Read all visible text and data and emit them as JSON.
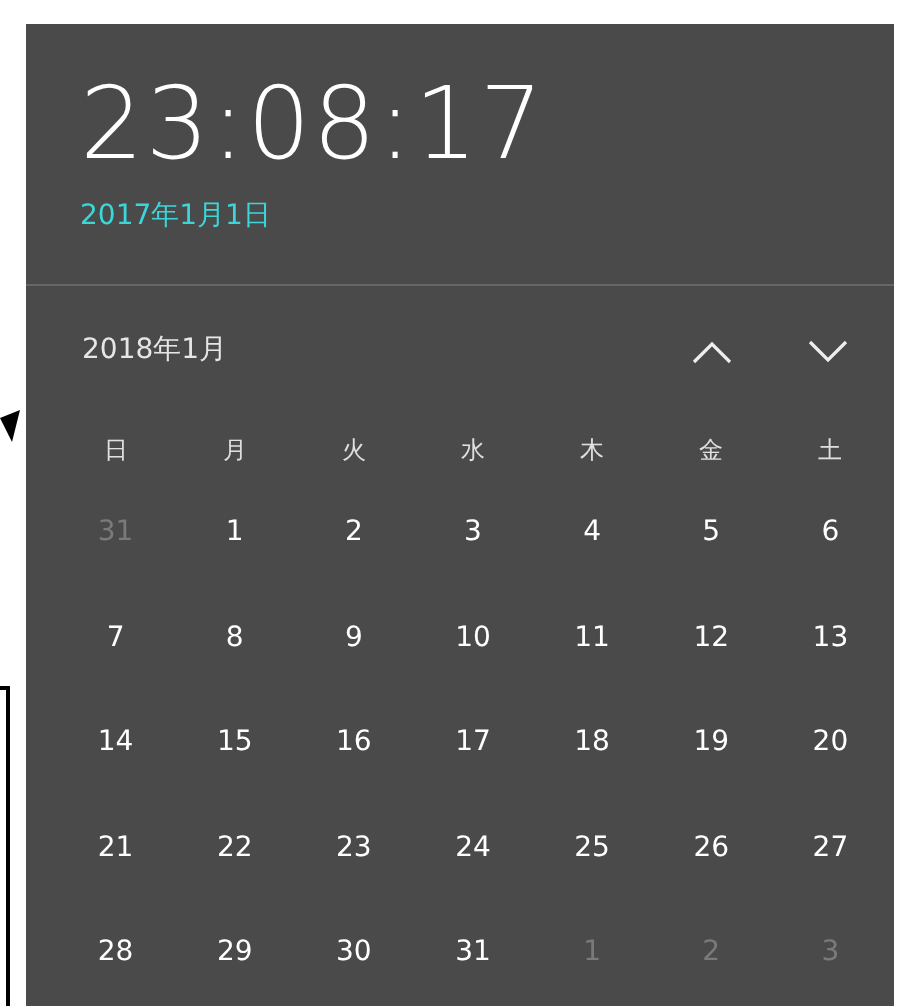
{
  "clock": {
    "time": "23:08:17",
    "date": "2017年1月1日"
  },
  "calendar": {
    "month_label": "2018年1月",
    "weekdays": [
      "日",
      "月",
      "火",
      "水",
      "木",
      "金",
      "土"
    ],
    "weeks": [
      [
        {
          "day": "31",
          "other_month": true
        },
        {
          "day": "1",
          "other_month": false
        },
        {
          "day": "2",
          "other_month": false
        },
        {
          "day": "3",
          "other_month": false
        },
        {
          "day": "4",
          "other_month": false
        },
        {
          "day": "5",
          "other_month": false
        },
        {
          "day": "6",
          "other_month": false
        }
      ],
      [
        {
          "day": "7",
          "other_month": false
        },
        {
          "day": "8",
          "other_month": false
        },
        {
          "day": "9",
          "other_month": false
        },
        {
          "day": "10",
          "other_month": false
        },
        {
          "day": "11",
          "other_month": false
        },
        {
          "day": "12",
          "other_month": false
        },
        {
          "day": "13",
          "other_month": false
        }
      ],
      [
        {
          "day": "14",
          "other_month": false
        },
        {
          "day": "15",
          "other_month": false
        },
        {
          "day": "16",
          "other_month": false
        },
        {
          "day": "17",
          "other_month": false
        },
        {
          "day": "18",
          "other_month": false
        },
        {
          "day": "19",
          "other_month": false
        },
        {
          "day": "20",
          "other_month": false
        }
      ],
      [
        {
          "day": "21",
          "other_month": false
        },
        {
          "day": "22",
          "other_month": false
        },
        {
          "day": "23",
          "other_month": false
        },
        {
          "day": "24",
          "other_month": false
        },
        {
          "day": "25",
          "other_month": false
        },
        {
          "day": "26",
          "other_month": false
        },
        {
          "day": "27",
          "other_month": false
        }
      ],
      [
        {
          "day": "28",
          "other_month": false
        },
        {
          "day": "29",
          "other_month": false
        },
        {
          "day": "30",
          "other_month": false
        },
        {
          "day": "31",
          "other_month": false
        },
        {
          "day": "1",
          "other_month": true
        },
        {
          "day": "2",
          "other_month": true
        },
        {
          "day": "3",
          "other_month": true
        }
      ]
    ]
  }
}
